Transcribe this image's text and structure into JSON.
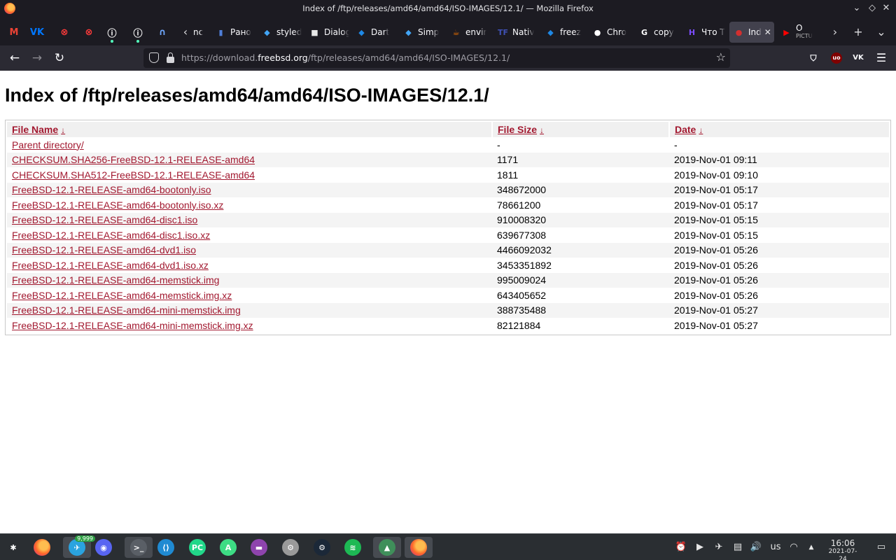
{
  "window": {
    "title": "Index of /ftp/releases/amd64/amd64/ISO-IMAGES/12.1/ — Mozilla Firefox",
    "controls": [
      "chevron-down-icon",
      "diamond-icon",
      "close-icon"
    ]
  },
  "tabs": {
    "pinned": [
      {
        "name": "gmail",
        "glyph": "M",
        "color": "#ea4335"
      },
      {
        "name": "vk",
        "glyph": "VK",
        "color": "#0077ff"
      },
      {
        "name": "opera-red-1",
        "glyph": "⊗",
        "color": "#ff3b3b"
      },
      {
        "name": "opera-red-2",
        "glyph": "⊗",
        "color": "#ff3b3b"
      },
      {
        "name": "info-1",
        "glyph": "ⓘ",
        "color": "#ffffff"
      },
      {
        "name": "info-2",
        "glyph": "ⓘ",
        "color": "#ffffff"
      },
      {
        "name": "magnet",
        "glyph": "∩",
        "color": "#6fa8ff"
      }
    ],
    "items": [
      {
        "label": "nc",
        "fav": "",
        "fav_color": "#4a4a55"
      },
      {
        "label": "Рано",
        "fav": "▮",
        "fav_color": "#4f7fd9"
      },
      {
        "label": "styled",
        "fav": "◆",
        "fav_color": "#42a5f5"
      },
      {
        "label": "Dialog",
        "fav": "■",
        "fav_color": "#e8e8e8"
      },
      {
        "label": "Dart",
        "fav": "◆",
        "fav_color": "#1e88e5"
      },
      {
        "label": "Simp",
        "fav": "◆",
        "fav_color": "#42a5f5"
      },
      {
        "label": "envir",
        "fav": "☕",
        "fav_color": "#e76f00"
      },
      {
        "label": "Nativ",
        "fav": "TF",
        "fav_color": "#3f51b5"
      },
      {
        "label": "freez",
        "fav": "◆",
        "fav_color": "#1e88e5"
      },
      {
        "label": "Chro",
        "fav": "●",
        "fav_color": "#ffffff"
      },
      {
        "label": "copy",
        "fav": "G",
        "fav_color": "#ffffff"
      },
      {
        "label": "Что Т",
        "fav": "H",
        "fav_color": "#7b4cff"
      },
      {
        "label": "Ind",
        "fav": "●",
        "fav_color": "#d32f2f",
        "active": true
      },
      {
        "label": "О",
        "fav": "▶",
        "fav_color": "#ff0000",
        "sub": "PICTU"
      }
    ],
    "new_tab": "+",
    "list_all": "⌄"
  },
  "nav": {
    "back": "←",
    "forward": "→",
    "reload": "↻",
    "url_prefix": "https://download.",
    "url_host": "freebsd.org",
    "url_path": "/ftp/releases/amd64/amd64/ISO-IMAGES/12.1/",
    "pocket": "⛉",
    "ublock": "uo",
    "vk_ext": "VK",
    "menu": "☰"
  },
  "page": {
    "heading": "Index of /ftp/releases/amd64/amd64/ISO-IMAGES/12.1/",
    "columns": {
      "name": "File Name",
      "size": "File Size",
      "date": "Date",
      "sort_arrow": "↓"
    },
    "rows": [
      {
        "name": "Parent directory/",
        "size": "-",
        "date": "-"
      },
      {
        "name": "CHECKSUM.SHA256-FreeBSD-12.1-RELEASE-amd64",
        "size": "1171",
        "date": "2019-Nov-01 09:11"
      },
      {
        "name": "CHECKSUM.SHA512-FreeBSD-12.1-RELEASE-amd64",
        "size": "1811",
        "date": "2019-Nov-01 09:10"
      },
      {
        "name": "FreeBSD-12.1-RELEASE-amd64-bootonly.iso",
        "size": "348672000",
        "date": "2019-Nov-01 05:17"
      },
      {
        "name": "FreeBSD-12.1-RELEASE-amd64-bootonly.iso.xz",
        "size": "78661200",
        "date": "2019-Nov-01 05:17"
      },
      {
        "name": "FreeBSD-12.1-RELEASE-amd64-disc1.iso",
        "size": "910008320",
        "date": "2019-Nov-01 05:15"
      },
      {
        "name": "FreeBSD-12.1-RELEASE-amd64-disc1.iso.xz",
        "size": "639677308",
        "date": "2019-Nov-01 05:15"
      },
      {
        "name": "FreeBSD-12.1-RELEASE-amd64-dvd1.iso",
        "size": "4466092032",
        "date": "2019-Nov-01 05:26"
      },
      {
        "name": "FreeBSD-12.1-RELEASE-amd64-dvd1.iso.xz",
        "size": "3453351892",
        "date": "2019-Nov-01 05:26"
      },
      {
        "name": "FreeBSD-12.1-RELEASE-amd64-memstick.img",
        "size": "995009024",
        "date": "2019-Nov-01 05:26"
      },
      {
        "name": "FreeBSD-12.1-RELEASE-amd64-memstick.img.xz",
        "size": "643405652",
        "date": "2019-Nov-01 05:26"
      },
      {
        "name": "FreeBSD-12.1-RELEASE-amd64-mini-memstick.img",
        "size": "388735488",
        "date": "2019-Nov-01 05:27"
      },
      {
        "name": "FreeBSD-12.1-RELEASE-amd64-mini-memstick.img.xz",
        "size": "82121884",
        "date": "2019-Nov-01 05:27"
      }
    ]
  },
  "taskbar": {
    "apps": [
      {
        "name": "app-launcher",
        "glyph": "✱",
        "bg": "transparent"
      },
      {
        "name": "firefox",
        "glyph": "",
        "bg": "transparent"
      },
      {
        "name": "telegram",
        "glyph": "✈",
        "bg": "#2aa3df",
        "badge": "9,999",
        "active": true
      },
      {
        "name": "discord",
        "glyph": "◉",
        "bg": "#5865f2"
      },
      {
        "name": "terminal",
        "glyph": ">_",
        "bg": "#5a5f66",
        "active": true
      },
      {
        "name": "vscode",
        "glyph": "⟨⟩",
        "bg": "#1f8ad2"
      },
      {
        "name": "pycharm",
        "glyph": "PC",
        "bg": "#21d789"
      },
      {
        "name": "android-studio",
        "glyph": "A",
        "bg": "#3ddc84"
      },
      {
        "name": "file-manager",
        "glyph": "▬",
        "bg": "#8e44ad"
      },
      {
        "name": "settings",
        "glyph": "⚙",
        "bg": "#9a9a9a"
      },
      {
        "name": "steam",
        "glyph": "⚙",
        "bg": "#1b2838"
      },
      {
        "name": "spotify",
        "glyph": "≋",
        "bg": "#1db954"
      },
      {
        "name": "android-device",
        "glyph": "▲",
        "bg": "#3f8f5a",
        "active": true
      },
      {
        "name": "firefox-running",
        "glyph": "",
        "bg": "transparent",
        "active": true
      }
    ],
    "tray": [
      {
        "name": "alarm-icon",
        "glyph": "⏰"
      },
      {
        "name": "media-play-icon",
        "glyph": "▶"
      },
      {
        "name": "telegram-tray-icon",
        "glyph": "✈"
      },
      {
        "name": "clipboard-icon",
        "glyph": "▤"
      },
      {
        "name": "volume-icon",
        "glyph": "🔊"
      }
    ],
    "keyboard_layout": "us",
    "wifi": "◠",
    "expand": "▲",
    "time": "16:06",
    "date": "2021-07-24",
    "show_desktop": "▭"
  }
}
